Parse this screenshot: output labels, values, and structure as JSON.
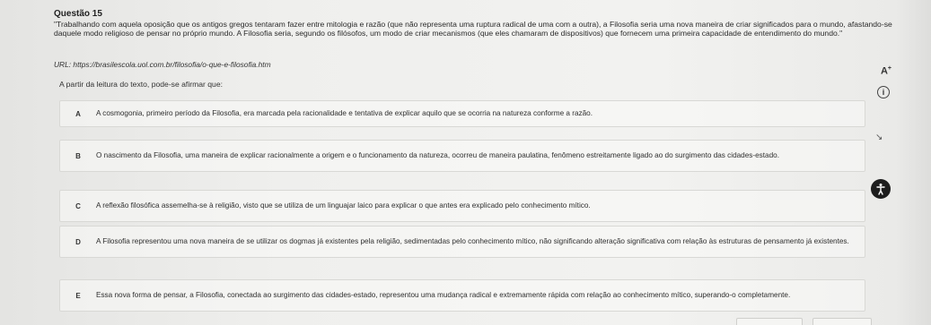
{
  "question": {
    "title": "Questão 15",
    "text": "\"Trabalhando com aquela oposição que os antigos gregos tentaram fazer entre mitologia e razão (que não representa uma ruptura radical de uma com a outra), a Filosofia seria uma nova maneira de criar significados para o mundo, afastando-se daquele modo religioso de pensar no próprio mundo. A Filosofia seria, segundo os filósofos, um modo de criar mecanismos (que eles chamaram de dispositivos) que fornecem uma primeira capacidade de entendimento do mundo.\"",
    "url": "URL: https://brasilescola.uol.com.br/filosofia/o-que-e-filosofia.htm",
    "prompt": "A partir da leitura do texto,  pode-se afirmar que:"
  },
  "tools": {
    "font_size_label": "A",
    "font_size_sup": "+"
  },
  "options": [
    {
      "letter": "A",
      "text": "A cosmogonia, primeiro período da Filosofia, era marcada pela racionalidade e tentativa de explicar aquilo que se ocorria na natureza conforme a razão."
    },
    {
      "letter": "B",
      "text": "O nascimento da Filosofia, uma maneira de explicar racionalmente a origem e o funcionamento da natureza, ocorreu de maneira paulatina, fenômeno estreitamente ligado ao do surgimento das cidades-estado."
    },
    {
      "letter": "C",
      "text": "A reflexão filosófica assemelha-se à religião, visto que se utiliza de um linguajar laico para explicar o que antes era explicado pelo conhecimento mítico."
    },
    {
      "letter": "D",
      "text": "A Filosofia representou uma nova maneira de se utilizar os dogmas já existentes pela religião, sedimentadas pelo conhecimento mítico, não significando alteração significativa com relação às estruturas de pensamento já existentes."
    },
    {
      "letter": "E",
      "text": "Essa nova forma de pensar, a Filosofia, conectada ao surgimento das cidades-estado, representou uma mudança radical e extremamente rápida com relação ao conhecimento mítico, superando-o completamente."
    }
  ],
  "icons": {
    "info": "info-icon",
    "accessibility": "accessibility-icon",
    "cursor": "cursor-icon"
  },
  "colors": {
    "background": "#ececea",
    "option_border": "#d8d8d5",
    "text": "#2a2a2a"
  }
}
